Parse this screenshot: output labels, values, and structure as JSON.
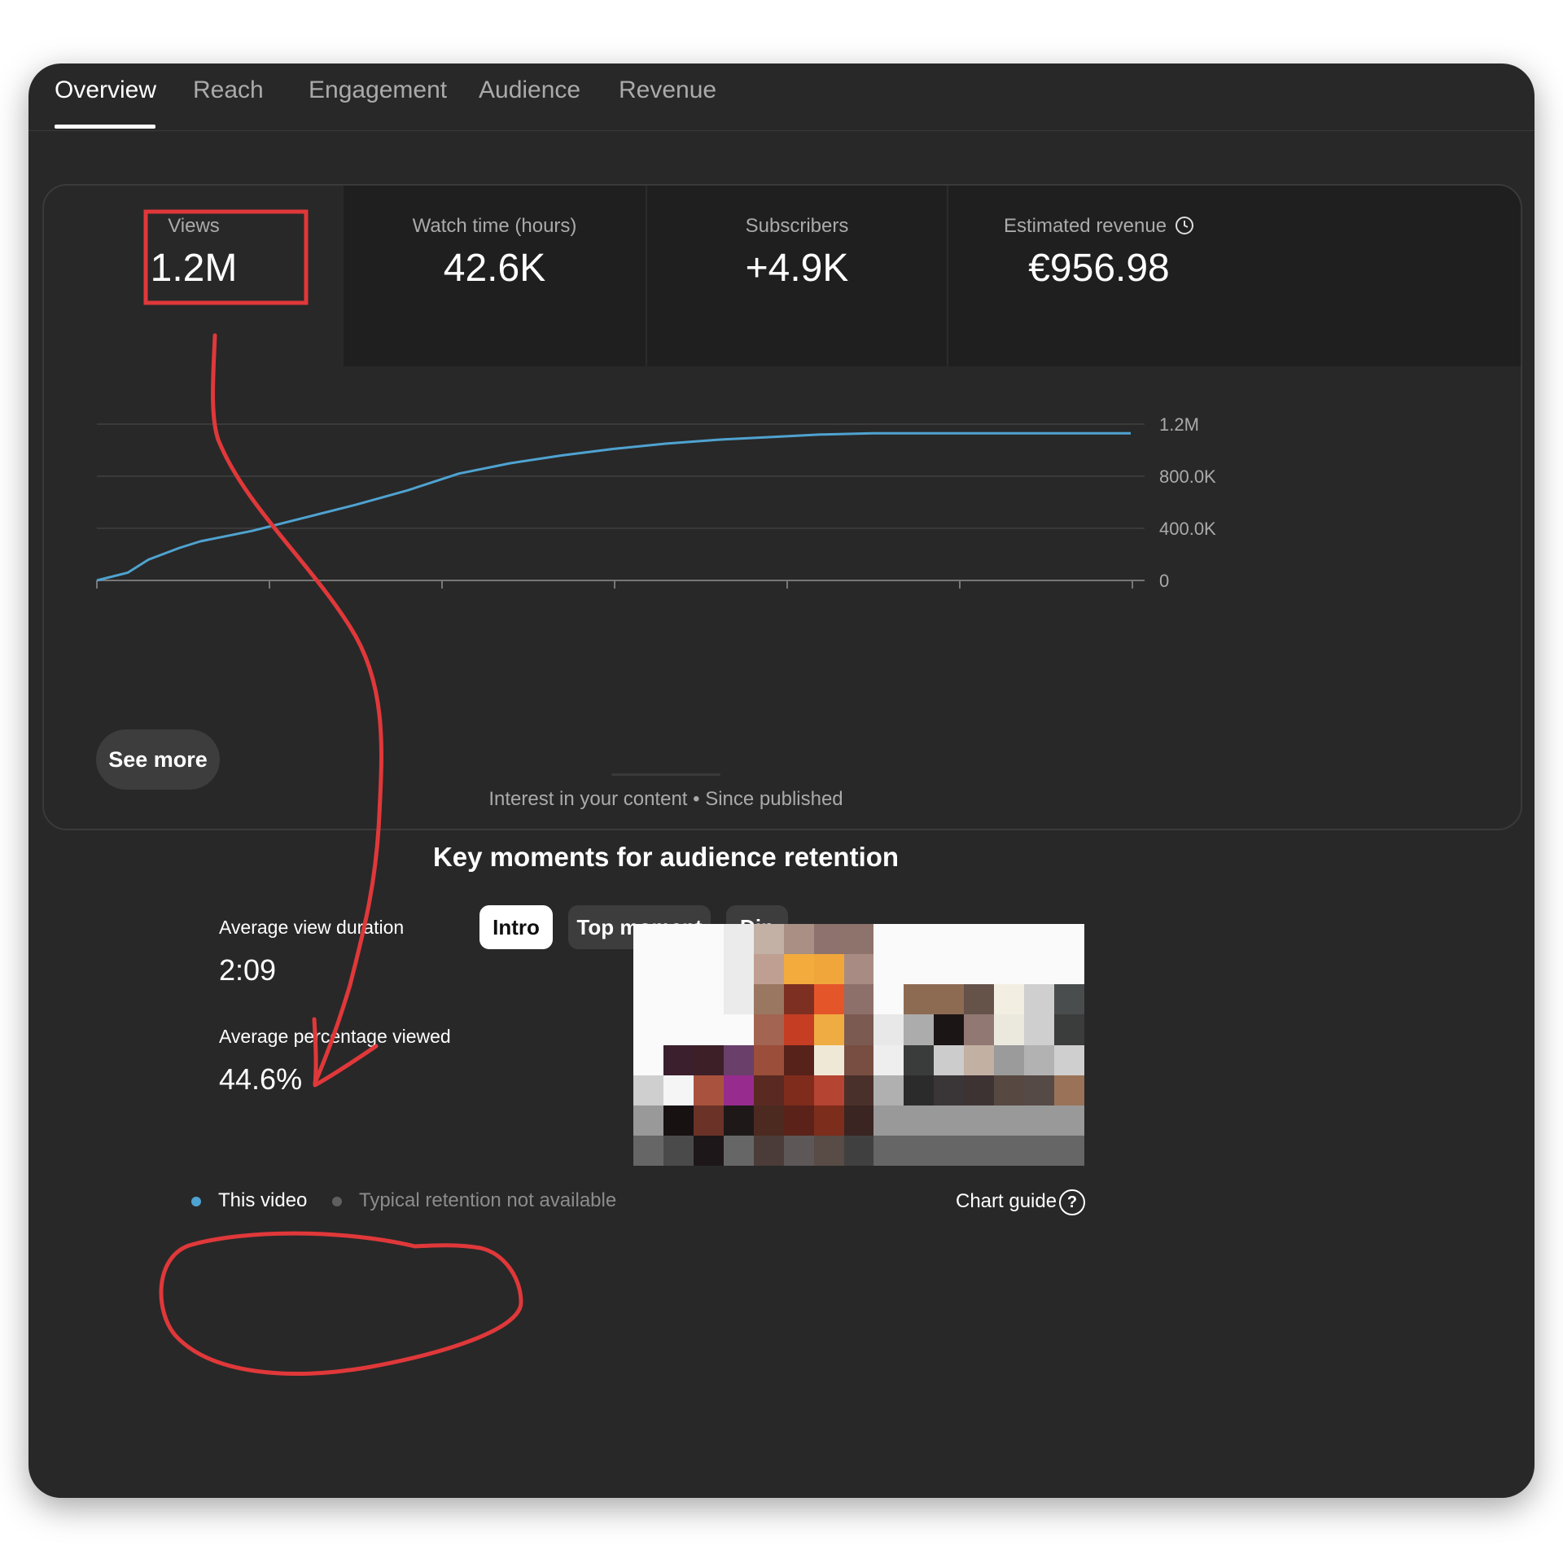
{
  "tabs": [
    {
      "label": "Overview",
      "active": true
    },
    {
      "label": "Reach",
      "active": false
    },
    {
      "label": "Engagement",
      "active": false
    },
    {
      "label": "Audience",
      "active": false
    },
    {
      "label": "Revenue",
      "active": false
    }
  ],
  "metrics": [
    {
      "label": "Views",
      "value": "1.2M"
    },
    {
      "label": "Watch time (hours)",
      "value": "42.6K"
    },
    {
      "label": "Subscribers",
      "value": "+4.9K"
    },
    {
      "label": "Estimated revenue",
      "value": "€956.98",
      "icon": "clock-icon"
    }
  ],
  "chart_data": {
    "type": "line",
    "series": [
      {
        "x": [
          0,
          0.03,
          0.05,
          0.08,
          0.1,
          0.15,
          0.2,
          0.25,
          0.3,
          0.35,
          0.4,
          0.45,
          0.5,
          0.55,
          0.6,
          0.65,
          0.7,
          0.75,
          0.8,
          1.0
        ],
        "values": [
          0,
          60000,
          160000,
          250000,
          300000,
          380000,
          480000,
          580000,
          690000,
          820000,
          900000,
          960000,
          1010000,
          1050000,
          1080000,
          1100000,
          1120000,
          1130000,
          1130000,
          1130000
        ]
      }
    ],
    "y_ticks": [
      "1.2M",
      "800.0K",
      "400.0K",
      "0"
    ],
    "ylim": [
      0,
      1200000
    ],
    "grid": true,
    "color": "#4fa3d1"
  },
  "see_more_label": "See more",
  "subtitle": "Interest in your content • Since published",
  "heading": "Key moments for audience retention",
  "chips": [
    {
      "label": "Intro",
      "selected": true
    },
    {
      "label": "Top moment",
      "selected": false
    },
    {
      "label": "Dip",
      "selected": false
    }
  ],
  "stats": [
    {
      "label": "Average view duration",
      "value": "2:09"
    },
    {
      "label": "Average percentage viewed",
      "value": "44.6%"
    }
  ],
  "legend": [
    {
      "label": "This video",
      "color": "#4fa3d1"
    },
    {
      "label": "Typical retention not available",
      "color": "#5f5f5f"
    }
  ],
  "chart_guide_label": "Chart guide",
  "colors": {
    "panel_bg": "#282828",
    "accent_line": "#4fa3d1",
    "annotation_red": "#e0383a"
  }
}
